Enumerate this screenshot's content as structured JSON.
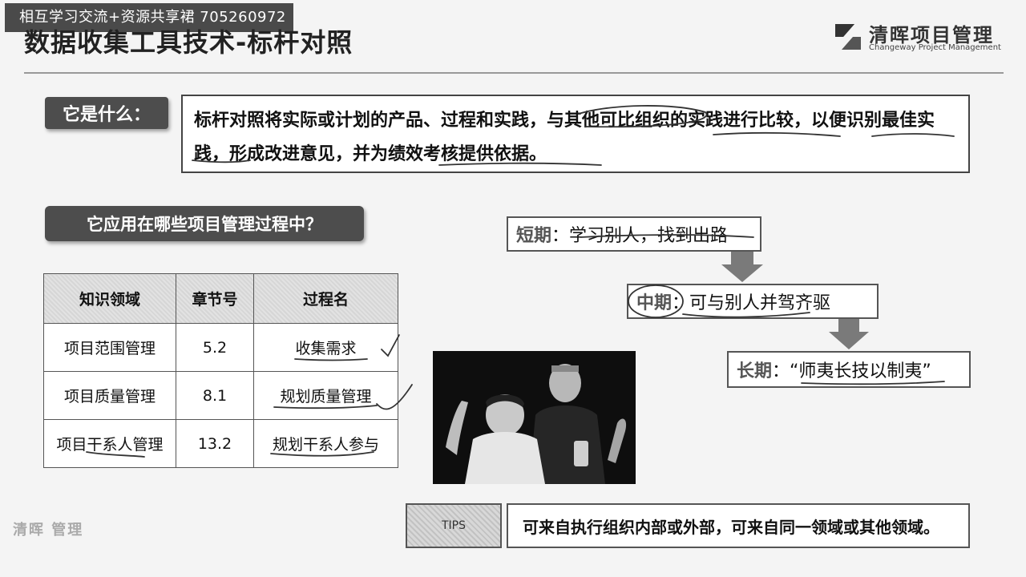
{
  "overlay": {
    "text": "相互学习交流+资源共享裙   705260972"
  },
  "header": {
    "title": "数据收集工具技术-标杆对照",
    "logo_cn": "清晖项目管理",
    "logo_en": "Changeway Project Management"
  },
  "what": {
    "label": "它是什么：",
    "definition": "标杆对照将实际或计划的产品、过程和实践，与其他可比组织的实践进行比较，以便识别最佳实践，形成改进意见，并为绩效考核提供依据。"
  },
  "apply": {
    "label": "它应用在哪些项目管理过程中？"
  },
  "table": {
    "headers": [
      "知识领域",
      "章节号",
      "过程名"
    ],
    "rows": [
      [
        "项目范围管理",
        "5.2",
        "收集需求"
      ],
      [
        "项目质量管理",
        "8.1",
        "规划质量管理"
      ],
      [
        "项目干系人管理",
        "13.2",
        "规划干系人参与"
      ]
    ]
  },
  "stages": {
    "short": {
      "name": "短期",
      "text": "：学习别人，找到出路"
    },
    "mid": {
      "name": "中期",
      "text": "：可与别人并驾齐驱"
    },
    "long": {
      "name": "长期",
      "text": "：“师夷长技以制夷”"
    }
  },
  "tips": {
    "tag": "TIPS",
    "text": "可来自执行组织内部或外部，可来自同一领域或其他领域。"
  },
  "watermark": {
    "text": "清晖 管理"
  },
  "colors": {
    "dark_label": "#4d4d4d",
    "arrow": "#7a7a7a",
    "border": "#555555"
  }
}
